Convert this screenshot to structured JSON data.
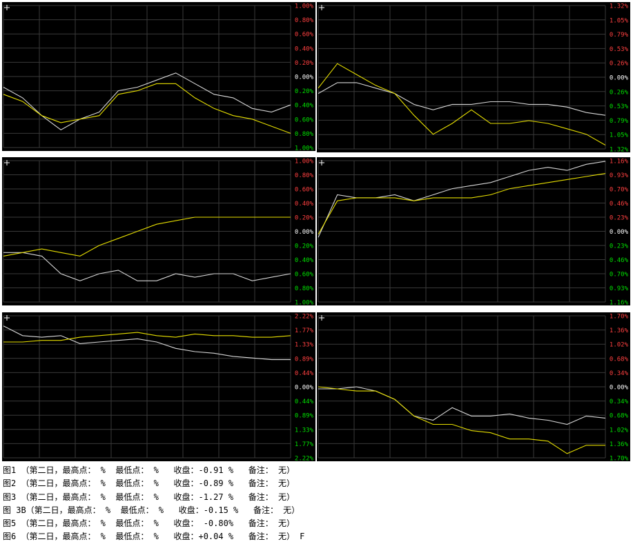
{
  "colors": {
    "background": "#000000",
    "grid": "#3a3a3a",
    "positive": "#ff4040",
    "negative": "#00e000",
    "zero": "#ffffff",
    "series_white": "#d8d8d8",
    "series_yellow": "#e8e000",
    "crosshair": "#ffffff"
  },
  "icons": {
    "corner": "plus-icon"
  },
  "chart_data": [
    {
      "type": "line",
      "ticks": [
        "1.00%",
        "0.80%",
        "0.60%",
        "0.40%",
        "0.20%",
        "0.00%",
        "0.20%",
        "0.40%",
        "0.60%",
        "0.80%",
        "1.00%"
      ],
      "ylim": [
        -1.0,
        1.0
      ],
      "grid": true,
      "series": [
        {
          "color": "white",
          "y": [
            -0.15,
            -0.3,
            -0.55,
            -0.75,
            -0.6,
            -0.5,
            -0.2,
            -0.15,
            -0.05,
            0.05,
            -0.1,
            -0.25,
            -0.3,
            -0.45,
            -0.5,
            -0.4
          ]
        },
        {
          "color": "yellow",
          "y": [
            -0.25,
            -0.35,
            -0.55,
            -0.65,
            -0.6,
            -0.55,
            -0.25,
            -0.2,
            -0.1,
            -0.1,
            -0.3,
            -0.45,
            -0.55,
            -0.6,
            -0.7,
            -0.8
          ]
        }
      ]
    },
    {
      "type": "line",
      "ticks": [
        "1.32%",
        "1.05%",
        "0.79%",
        "0.53%",
        "0.26%",
        "0.00%",
        "0.26%",
        "0.53%",
        "0.79%",
        "1.05%",
        "1.32%"
      ],
      "ylim": [
        -1.32,
        1.32
      ],
      "grid": true,
      "series": [
        {
          "color": "white",
          "y": [
            -0.3,
            -0.1,
            -0.1,
            -0.2,
            -0.3,
            -0.5,
            -0.6,
            -0.5,
            -0.5,
            -0.45,
            -0.45,
            -0.5,
            -0.5,
            -0.55,
            -0.65,
            -0.7
          ]
        },
        {
          "color": "yellow",
          "y": [
            -0.2,
            0.25,
            0.05,
            -0.15,
            -0.3,
            -0.7,
            -1.05,
            -0.85,
            -0.6,
            -0.85,
            -0.85,
            -0.8,
            -0.85,
            -0.95,
            -1.05,
            -1.25
          ]
        }
      ]
    },
    {
      "type": "line",
      "ticks": [
        "1.00%",
        "0.80%",
        "0.60%",
        "0.40%",
        "0.20%",
        "0.00%",
        "0.20%",
        "0.40%",
        "0.60%",
        "0.80%",
        "1.00%"
      ],
      "ylim": [
        -1.0,
        1.0
      ],
      "grid": true,
      "series": [
        {
          "color": "white",
          "y": [
            -0.3,
            -0.3,
            -0.35,
            -0.6,
            -0.7,
            -0.6,
            -0.55,
            -0.7,
            -0.7,
            -0.6,
            -0.65,
            -0.6,
            -0.6,
            -0.7,
            -0.65,
            -0.6
          ]
        },
        {
          "color": "yellow",
          "y": [
            -0.35,
            -0.3,
            -0.25,
            -0.3,
            -0.35,
            -0.2,
            -0.1,
            0.0,
            0.1,
            0.15,
            0.2,
            0.2,
            0.2,
            0.2,
            0.2,
            0.2
          ]
        }
      ]
    },
    {
      "type": "line",
      "ticks": [
        "1.16%",
        "0.93%",
        "0.70%",
        "0.46%",
        "0.23%",
        "0.00%",
        "0.23%",
        "0.46%",
        "0.70%",
        "0.93%",
        "1.16%"
      ],
      "ylim": [
        -1.16,
        1.16
      ],
      "grid": true,
      "series": [
        {
          "color": "white",
          "y": [
            -0.1,
            0.6,
            0.55,
            0.55,
            0.6,
            0.5,
            0.6,
            0.7,
            0.75,
            0.8,
            0.9,
            1.0,
            1.05,
            1.0,
            1.1,
            1.15
          ]
        },
        {
          "color": "yellow",
          "y": [
            -0.05,
            0.5,
            0.55,
            0.55,
            0.55,
            0.5,
            0.55,
            0.55,
            0.55,
            0.6,
            0.7,
            0.75,
            0.8,
            0.85,
            0.9,
            0.95
          ]
        }
      ]
    },
    {
      "type": "line",
      "ticks": [
        "2.22%",
        "1.77%",
        "1.33%",
        "0.89%",
        "0.44%",
        "0.00%",
        "0.44%",
        "0.89%",
        "1.33%",
        "1.77%",
        "2.22%"
      ],
      "ylim": [
        -2.22,
        2.22
      ],
      "grid": true,
      "series": [
        {
          "color": "white",
          "y": [
            1.9,
            1.6,
            1.55,
            1.6,
            1.35,
            1.4,
            1.45,
            1.5,
            1.4,
            1.2,
            1.1,
            1.05,
            0.95,
            0.9,
            0.85,
            0.85
          ]
        },
        {
          "color": "yellow",
          "y": [
            1.4,
            1.4,
            1.45,
            1.45,
            1.55,
            1.6,
            1.65,
            1.7,
            1.6,
            1.55,
            1.65,
            1.6,
            1.6,
            1.55,
            1.55,
            1.6
          ]
        }
      ]
    },
    {
      "type": "line",
      "ticks": [
        "1.70%",
        "1.36%",
        "1.02%",
        "0.68%",
        "0.34%",
        "0.00%",
        "0.34%",
        "0.68%",
        "1.02%",
        "1.36%",
        "1.70%"
      ],
      "ylim": [
        -1.7,
        1.7
      ],
      "grid": true,
      "series": [
        {
          "color": "white",
          "y": [
            -0.05,
            -0.05,
            0.0,
            -0.1,
            -0.3,
            -0.7,
            -0.8,
            -0.5,
            -0.7,
            -0.7,
            -0.65,
            -0.75,
            -0.8,
            -0.9,
            -0.7,
            -0.75
          ]
        },
        {
          "color": "yellow",
          "y": [
            0.0,
            -0.05,
            -0.1,
            -0.1,
            -0.3,
            -0.7,
            -0.9,
            -0.9,
            -1.05,
            -1.1,
            -1.25,
            -1.25,
            -1.3,
            -1.6,
            -1.4,
            -1.4
          ]
        }
      ]
    }
  ],
  "captions": [
    "图1 （第二日，最高点： %  最低点： %   收盘：-0.91 %   备注： 无）",
    "图2 （第二日，最高点： %  最低点： %   收盘：-0.89 %   备注： 无）",
    "图3 （第二日，最高点： %  最低点： %   收盘：-1.27 %   备注： 无）",
    "图 3B（第二日，最高点： %  最低点： %   收盘：-0.15 %   备注： 无）",
    "图5 （第二日，最高点： %  最低点： %   收盘： -0.80%   备注： 无）",
    "图6 （第二日，最高点： %  最低点： %   收盘：+0.04 %   备注： 无） F"
  ]
}
